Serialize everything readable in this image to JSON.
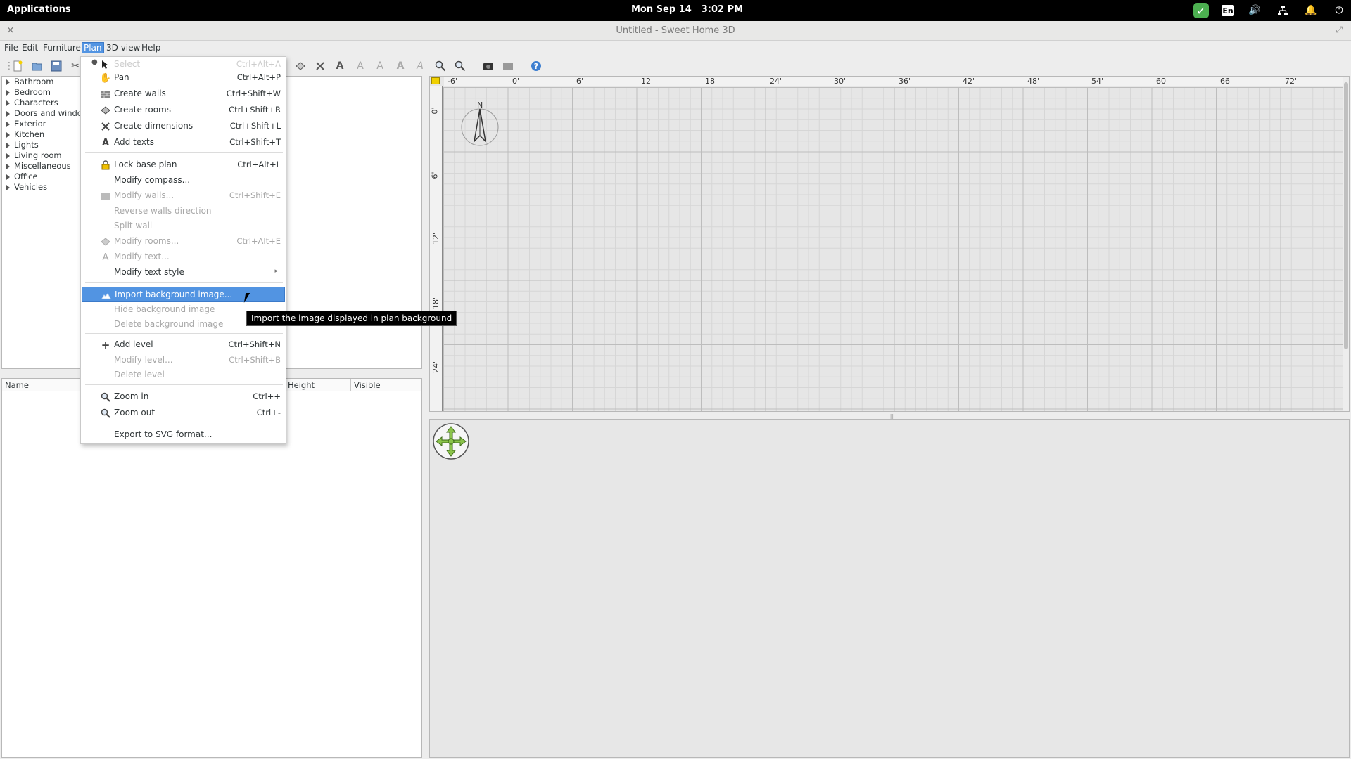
{
  "system_bar": {
    "applications": "Applications",
    "date": "Mon Sep 14",
    "time": "3:02 PM",
    "keyboard_layout": "En"
  },
  "window": {
    "title": "Untitled - Sweet Home 3D"
  },
  "menubar": {
    "file": "File",
    "edit": "Edit",
    "furniture": "Furniture",
    "plan": "Plan",
    "view3d": "3D view",
    "help": "Help"
  },
  "catalog": {
    "categories": [
      "Bathroom",
      "Bedroom",
      "Characters",
      "Doors and windows",
      "Exterior",
      "Kitchen",
      "Lights",
      "Living room",
      "Miscellaneous",
      "Office",
      "Vehicles"
    ]
  },
  "furniture_table": {
    "columns": [
      "Name",
      "Height",
      "Visible"
    ]
  },
  "plan": {
    "h_ruler": [
      "-6'",
      "0'",
      "6'",
      "12'",
      "18'",
      "24'",
      "30'",
      "36'",
      "42'",
      "48'",
      "54'",
      "60'",
      "66'",
      "72'"
    ],
    "v_ruler": [
      "0'",
      "6'",
      "12'",
      "18'",
      "24'"
    ],
    "compass_label": "N"
  },
  "plan_menu": {
    "items": [
      {
        "label": "Select",
        "shortcut": "Ctrl+Alt+A",
        "icon": "arrow-pointer-icon",
        "disabled": false,
        "radio": true
      },
      {
        "label": "Pan",
        "shortcut": "Ctrl+Alt+P",
        "icon": "hand-icon",
        "disabled": false
      },
      {
        "label": "Create walls",
        "shortcut": "Ctrl+Shift+W",
        "icon": "wall-icon",
        "disabled": false
      },
      {
        "label": "Create rooms",
        "shortcut": "Ctrl+Shift+R",
        "icon": "room-icon",
        "disabled": false
      },
      {
        "label": "Create dimensions",
        "shortcut": "Ctrl+Shift+L",
        "icon": "dimension-icon",
        "disabled": false
      },
      {
        "label": "Add texts",
        "shortcut": "Ctrl+Shift+T",
        "icon": "text-icon",
        "disabled": false
      },
      {
        "label": "Lock base plan",
        "shortcut": "Ctrl+Alt+L",
        "icon": "lock-icon",
        "disabled": false
      },
      {
        "label": "Modify compass...",
        "shortcut": "",
        "icon": "",
        "disabled": false
      },
      {
        "label": "Modify walls...",
        "shortcut": "Ctrl+Shift+E",
        "icon": "wall-icon",
        "disabled": true
      },
      {
        "label": "Reverse walls direction",
        "shortcut": "",
        "icon": "",
        "disabled": true
      },
      {
        "label": "Split wall",
        "shortcut": "",
        "icon": "",
        "disabled": true
      },
      {
        "label": "Modify rooms...",
        "shortcut": "Ctrl+Alt+E",
        "icon": "room-icon",
        "disabled": true
      },
      {
        "label": "Modify text...",
        "shortcut": "",
        "icon": "text-icon",
        "disabled": true
      },
      {
        "label": "Modify text style",
        "shortcut": "",
        "icon": "",
        "disabled": false,
        "submenu": true
      },
      {
        "label": "Import background image...",
        "shortcut": "",
        "icon": "image-icon",
        "disabled": false,
        "highlighted": true
      },
      {
        "label": "Hide background image",
        "shortcut": "",
        "icon": "",
        "disabled": true
      },
      {
        "label": "Delete background image",
        "shortcut": "",
        "icon": "",
        "disabled": true
      },
      {
        "label": "Add level",
        "shortcut": "Ctrl+Shift+N",
        "icon": "plus-icon",
        "disabled": false
      },
      {
        "label": "Modify level...",
        "shortcut": "Ctrl+Shift+B",
        "icon": "",
        "disabled": true
      },
      {
        "label": "Delete level",
        "shortcut": "",
        "icon": "",
        "disabled": true
      },
      {
        "label": "Zoom in",
        "shortcut": "Ctrl++",
        "icon": "zoom-in-icon",
        "disabled": false
      },
      {
        "label": "Zoom out",
        "shortcut": "Ctrl+-",
        "icon": "zoom-out-icon",
        "disabled": false
      },
      {
        "label": "Export to SVG format...",
        "shortcut": "",
        "icon": "",
        "disabled": false
      }
    ]
  },
  "tooltip": {
    "text": "Import the image displayed in plan background"
  },
  "colors": {
    "highlight": "#5294e2",
    "system_bar": "#000000",
    "check_green": "#4caf50"
  }
}
